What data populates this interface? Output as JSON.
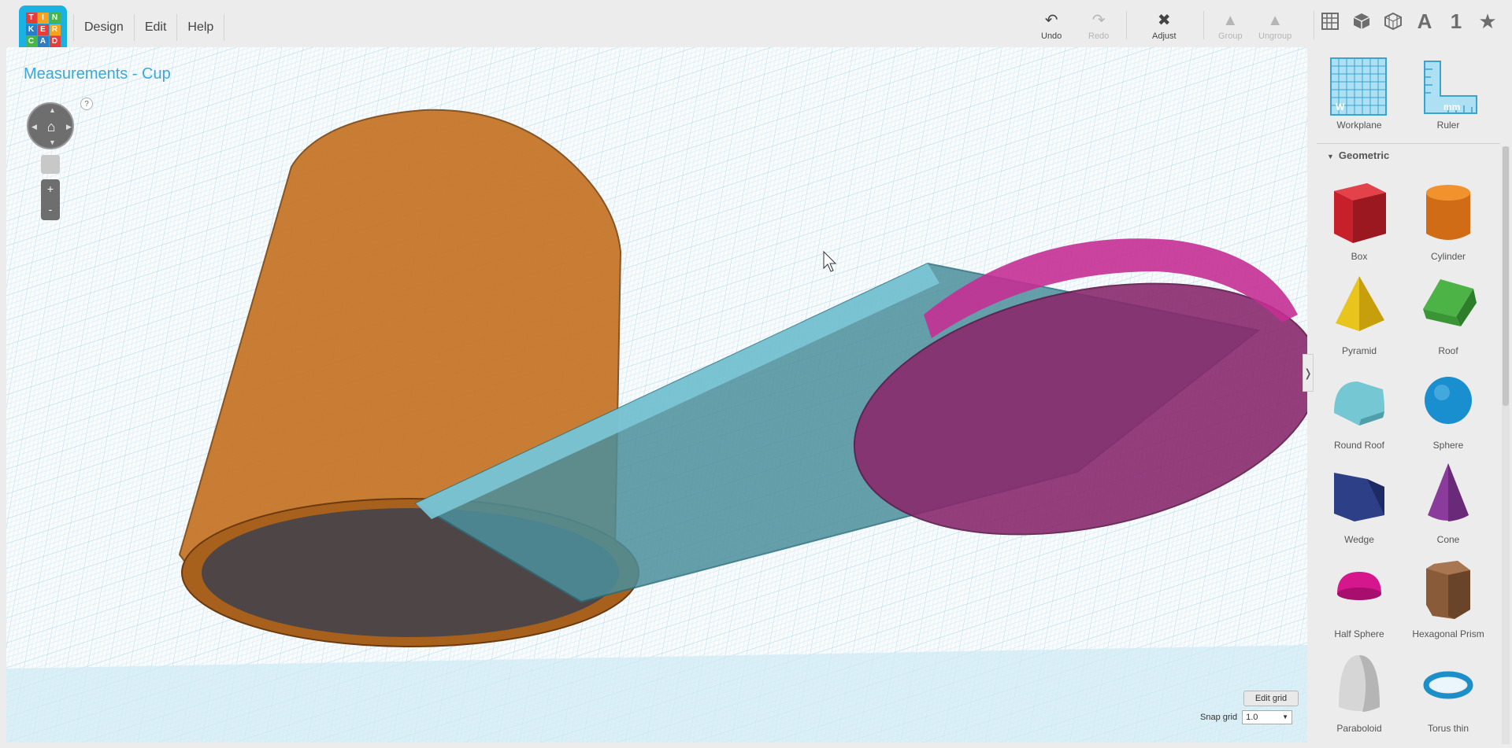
{
  "logo": {
    "letters": [
      "T",
      "I",
      "N",
      "K",
      "E",
      "R",
      "C",
      "A",
      "D"
    ]
  },
  "menu": {
    "design": "Design",
    "edit": "Edit",
    "help": "Help"
  },
  "toolbar": {
    "undo": "Undo",
    "redo": "Redo",
    "adjust": "Adjust",
    "group": "Group",
    "ungroup": "Ungroup"
  },
  "view_icons": {
    "text_a": "A",
    "text_1": "1"
  },
  "canvas": {
    "title": "Measurements - Cup",
    "help": "?",
    "zoom_in": "+",
    "zoom_out": "-",
    "edit_grid": "Edit grid",
    "snap_label": "Snap grid",
    "snap_value": "1.0"
  },
  "sidebar": {
    "workplane": "Workplane",
    "ruler": "Ruler",
    "ruler_unit": "mm",
    "workplane_mark": "W",
    "category": "Geometric",
    "shapes": [
      {
        "label": "Box",
        "color": "#c8202b"
      },
      {
        "label": "Cylinder",
        "color": "#e47b1f"
      },
      {
        "label": "Pyramid",
        "color": "#e8c41c"
      },
      {
        "label": "Roof",
        "color": "#3f9c3a"
      },
      {
        "label": "Round Roof",
        "color": "#74c7d3"
      },
      {
        "label": "Sphere",
        "color": "#1a8fd0"
      },
      {
        "label": "Wedge",
        "color": "#2d3f86"
      },
      {
        "label": "Cone",
        "color": "#8a3b9c"
      },
      {
        "label": "Half Sphere",
        "color": "#d6168c"
      },
      {
        "label": "Hexagonal Prism",
        "color": "#8a5b38"
      },
      {
        "label": "Paraboloid",
        "color": "#d6d6d6"
      },
      {
        "label": "Torus thin",
        "color": "#1d8fc8"
      }
    ]
  }
}
